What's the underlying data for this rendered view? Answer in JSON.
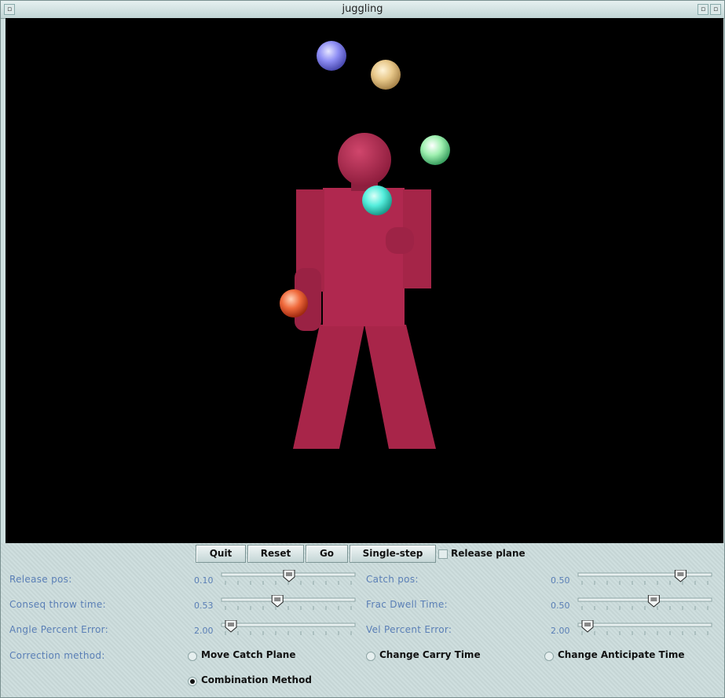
{
  "window": {
    "title": "juggling"
  },
  "buttons": {
    "quit": "Quit",
    "reset": "Reset",
    "go": "Go",
    "single_step": "Single-step"
  },
  "release_plane": {
    "label": "Release plane",
    "checked": false
  },
  "sliders": {
    "release_pos": {
      "label": "Release pos:",
      "value": "0.10",
      "fraction": 0.5
    },
    "catch_pos": {
      "label": "Catch pos:",
      "value": "0.50",
      "fraction": 0.8
    },
    "conseq_throw": {
      "label": "Conseq throw time:",
      "value": "0.53",
      "fraction": 0.4
    },
    "frac_dwell": {
      "label": "Frac Dwell Time:",
      "value": "0.50",
      "fraction": 0.57
    },
    "angle_error": {
      "label": "Angle Percent Error:",
      "value": "2.00",
      "fraction": 0.0
    },
    "vel_error": {
      "label": "Vel Percent Error:",
      "value": "2.00",
      "fraction": 0.0
    }
  },
  "correction": {
    "label": "Correction method:",
    "options": [
      "Move Catch Plane",
      "Change Carry Time",
      "Change Anticipate Time",
      "Combination Method"
    ],
    "selected": "Combination Method"
  },
  "colors": {
    "figure": "#b0284f",
    "ball_blue": "#8f8ff5",
    "ball_tan": "#e8c88a",
    "ball_green": "#9ff0b0",
    "ball_cyan": "#55eedd",
    "ball_orange": "#f06a3c"
  }
}
